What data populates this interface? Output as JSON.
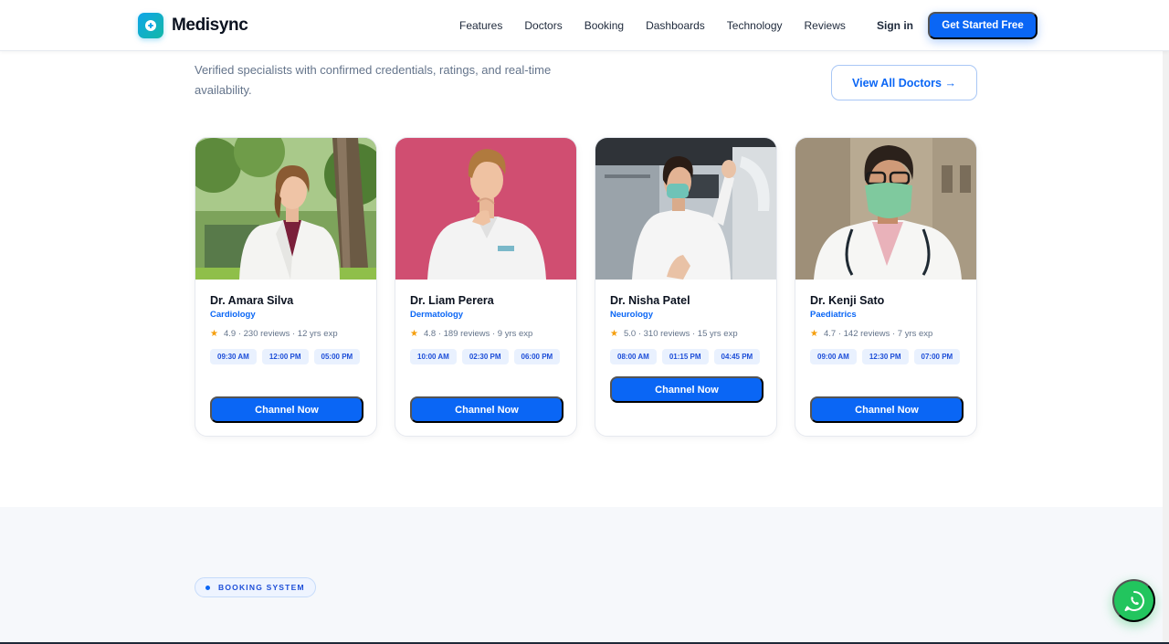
{
  "brand": {
    "name": "Medisync"
  },
  "nav": {
    "links": [
      "Features",
      "Doctors",
      "Booking",
      "Dashboards",
      "Technology",
      "Reviews"
    ],
    "signin": "Sign in",
    "cta": "Get Started Free"
  },
  "doctors_section": {
    "subtitle": "Verified specialists with confirmed credentials, ratings, and real-time availability.",
    "view_all": "View All Doctors →"
  },
  "doctors": [
    {
      "name": "Dr. Amara Silva",
      "specialty": "Cardiology",
      "rating": "4.9",
      "reviews": "230 reviews",
      "experience": "12 yrs exp",
      "slots": [
        "09:30 AM",
        "12:00 PM",
        "05:00 PM"
      ],
      "button": "Channel Now"
    },
    {
      "name": "Dr. Liam Perera",
      "specialty": "Dermatology",
      "rating": "4.8",
      "reviews": "189 reviews",
      "experience": "9 yrs exp",
      "slots": [
        "10:00 AM",
        "02:30 PM",
        "06:00 PM"
      ],
      "button": "Channel Now"
    },
    {
      "name": "Dr. Nisha Patel",
      "specialty": "Neurology",
      "rating": "5.0",
      "reviews": "310 reviews",
      "experience": "15 yrs exp",
      "slots": [
        "08:00 AM",
        "01:15 PM",
        "04:45 PM"
      ],
      "button": "Channel Now"
    },
    {
      "name": "Dr. Kenji Sato",
      "specialty": "Paediatrics",
      "rating": "4.7",
      "reviews": "142 reviews",
      "experience": "7 yrs exp",
      "slots": [
        "09:00 AM",
        "12:30 PM",
        "07:00 PM"
      ],
      "button": "Channel Now"
    }
  ],
  "booking_section": {
    "pill": "BOOKING SYSTEM"
  },
  "icons": {
    "rating": "star-icon",
    "chat": "whatsapp-icon",
    "logo": "medical-plus-icon"
  },
  "colors": {
    "primary": "#0a66f5",
    "accent": "#14b8a6",
    "star": "#f59e0b",
    "whatsapp": "#22c55e"
  }
}
